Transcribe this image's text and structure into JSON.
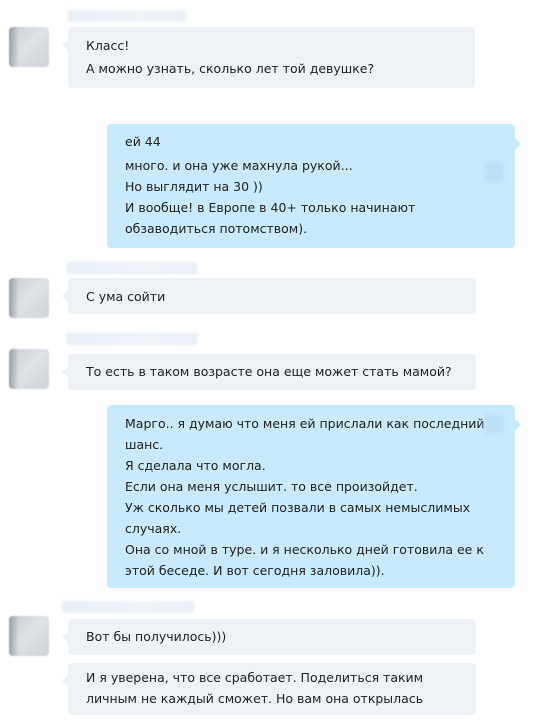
{
  "messages": [
    {
      "lines": [
        "Класс!",
        "А можно узнать, сколько лет той девушке?"
      ]
    },
    {
      "lines": [
        "ей 44",
        "много. и она уже махнула рукой...",
        "Но выглядит на 30 ))",
        "И вообще! в Европе в 40+ только начинают",
        "обзаводиться потомством)."
      ]
    },
    {
      "lines": [
        "С ума сойти"
      ]
    },
    {
      "lines": [
        "То есть в таком возрасте она еще может стать мамой?"
      ]
    },
    {
      "lines": [
        "Марго.. я думаю что меня ей прислали как последний",
        "шанс.",
        "Я сделала что могла.",
        "Если она меня услышит. то все произойдет.",
        "Уж сколько мы детей позвали в самых немыслимых",
        "случаях.",
        "Она со мной в туре. и я несколько дней готовила ее к",
        "этой беседе. И вот сегодня заловила))."
      ]
    },
    {
      "lines": [
        "Вот бы получилось)))"
      ]
    },
    {
      "lines": [
        "И я уверена, что все сработает. Поделиться таким",
        "личным не каждый сможет. Но вам она открылась"
      ]
    }
  ]
}
